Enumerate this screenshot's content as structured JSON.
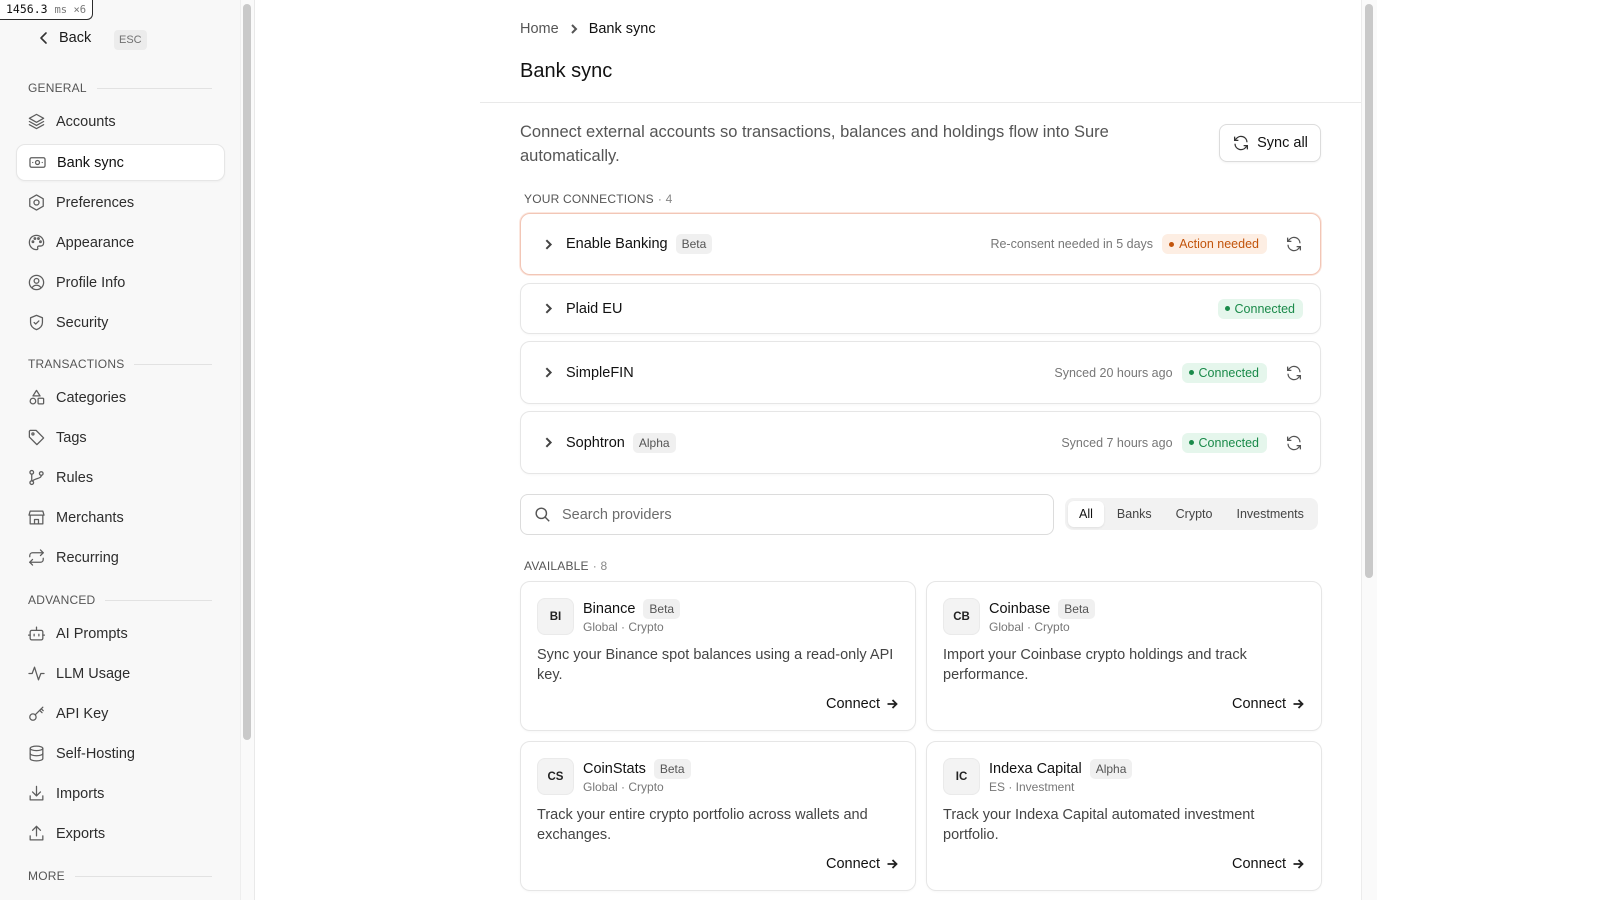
{
  "perf": {
    "value": "1456.3",
    "unit": "ms ×6"
  },
  "sidebar": {
    "back_label": "Back",
    "esc_label": "ESC",
    "sections": {
      "general": "GENERAL",
      "transactions": "TRANSACTIONS",
      "advanced": "ADVANCED",
      "more": "MORE"
    },
    "items": {
      "accounts": "Accounts",
      "bank_sync": "Bank sync",
      "preferences": "Preferences",
      "appearance": "Appearance",
      "profile_info": "Profile Info",
      "security": "Security",
      "categories": "Categories",
      "tags": "Tags",
      "rules": "Rules",
      "merchants": "Merchants",
      "recurring": "Recurring",
      "ai_prompts": "AI Prompts",
      "llm_usage": "LLM Usage",
      "api_key": "API Key",
      "self_hosting": "Self-Hosting",
      "imports": "Imports",
      "exports": "Exports"
    }
  },
  "breadcrumb": {
    "home": "Home",
    "current": "Bank sync"
  },
  "page_title": "Bank sync",
  "description": "Connect external accounts so transactions, balances and holdings flow into Sure automatically.",
  "sync_all_label": "Sync all",
  "connections": {
    "title": "YOUR CONNECTIONS",
    "count": "· 4",
    "items": [
      {
        "name": "Enable Banking",
        "badge": "Beta",
        "meta": "Re-consent needed in 5 days",
        "status": "Action needed"
      },
      {
        "name": "Plaid EU",
        "badge": "",
        "meta": "",
        "status": "Connected"
      },
      {
        "name": "SimpleFIN",
        "badge": "",
        "meta": "Synced 20 hours ago",
        "status": "Connected"
      },
      {
        "name": "Sophtron",
        "badge": "Alpha",
        "meta": "Synced 7 hours ago",
        "status": "Connected"
      }
    ]
  },
  "search": {
    "placeholder": "Search providers"
  },
  "filters": {
    "all": "All",
    "banks": "Banks",
    "crypto": "Crypto",
    "investments": "Investments"
  },
  "available": {
    "title": "AVAILABLE",
    "count": "· 8",
    "connect_label": "Connect",
    "providers": [
      {
        "initials": "BI",
        "name": "Binance",
        "badge": "Beta",
        "sub": "Global · Crypto",
        "desc": "Sync your Binance spot balances using a read-only API key."
      },
      {
        "initials": "CB",
        "name": "Coinbase",
        "badge": "Beta",
        "sub": "Global · Crypto",
        "desc": "Import your Coinbase crypto holdings and track performance."
      },
      {
        "initials": "CS",
        "name": "CoinStats",
        "badge": "Beta",
        "sub": "Global · Crypto",
        "desc": "Track your entire crypto portfolio across wallets and exchanges."
      },
      {
        "initials": "IC",
        "name": "Indexa Capital",
        "badge": "Alpha",
        "sub": "ES · Investment",
        "desc": "Track your Indexa Capital automated investment portfolio."
      }
    ]
  }
}
